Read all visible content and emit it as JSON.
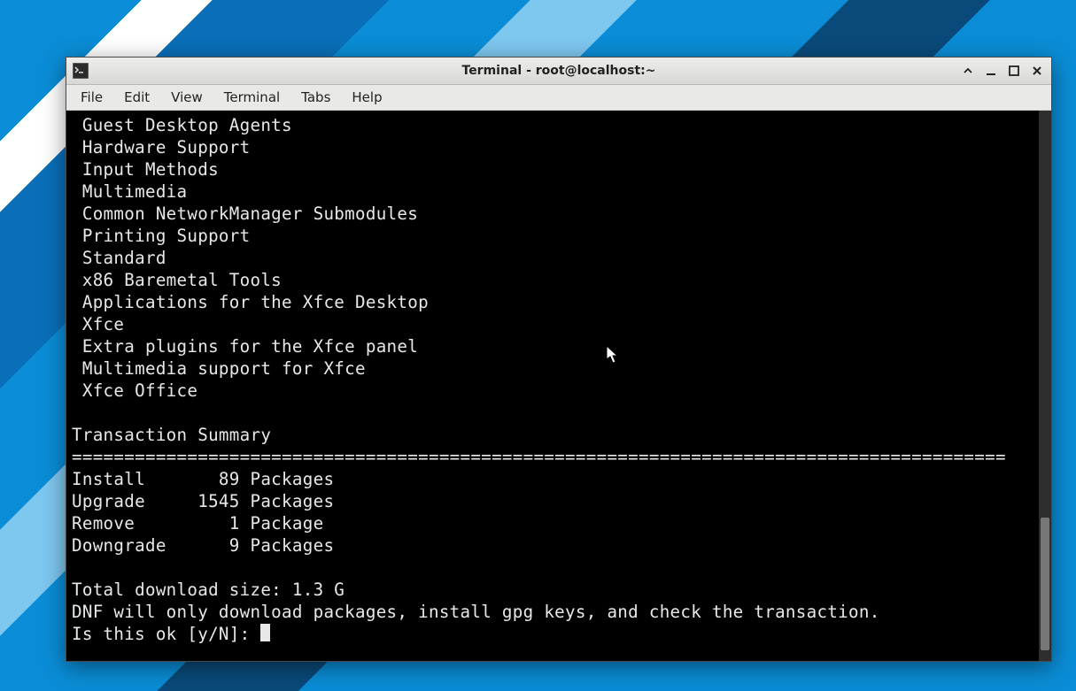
{
  "window": {
    "title": "Terminal - root@localhost:~"
  },
  "menubar": {
    "items": [
      "File",
      "Edit",
      "View",
      "Terminal",
      "Tabs",
      "Help"
    ]
  },
  "terminal": {
    "groups": [
      " Guest Desktop Agents",
      " Hardware Support",
      " Input Methods",
      " Multimedia",
      " Common NetworkManager Submodules",
      " Printing Support",
      " Standard",
      " x86 Baremetal Tools",
      " Applications for the Xfce Desktop",
      " Xfce",
      " Extra plugins for the Xfce panel",
      " Multimedia support for Xfce",
      " Xfce Office"
    ],
    "summary_heading": "Transaction Summary",
    "separator": "=========================================================================================",
    "summary_rows": [
      {
        "action": "Install",
        "count": "89",
        "unit": "Packages"
      },
      {
        "action": "Upgrade",
        "count": "1545",
        "unit": "Packages"
      },
      {
        "action": "Remove",
        "count": "1",
        "unit": "Package"
      },
      {
        "action": "Downgrade",
        "count": "9",
        "unit": "Packages"
      }
    ],
    "total_size": "Total download size: 1.3 G",
    "notice": "DNF will only download packages, install gpg keys, and check the transaction.",
    "prompt": "Is this ok [y/N]: "
  }
}
